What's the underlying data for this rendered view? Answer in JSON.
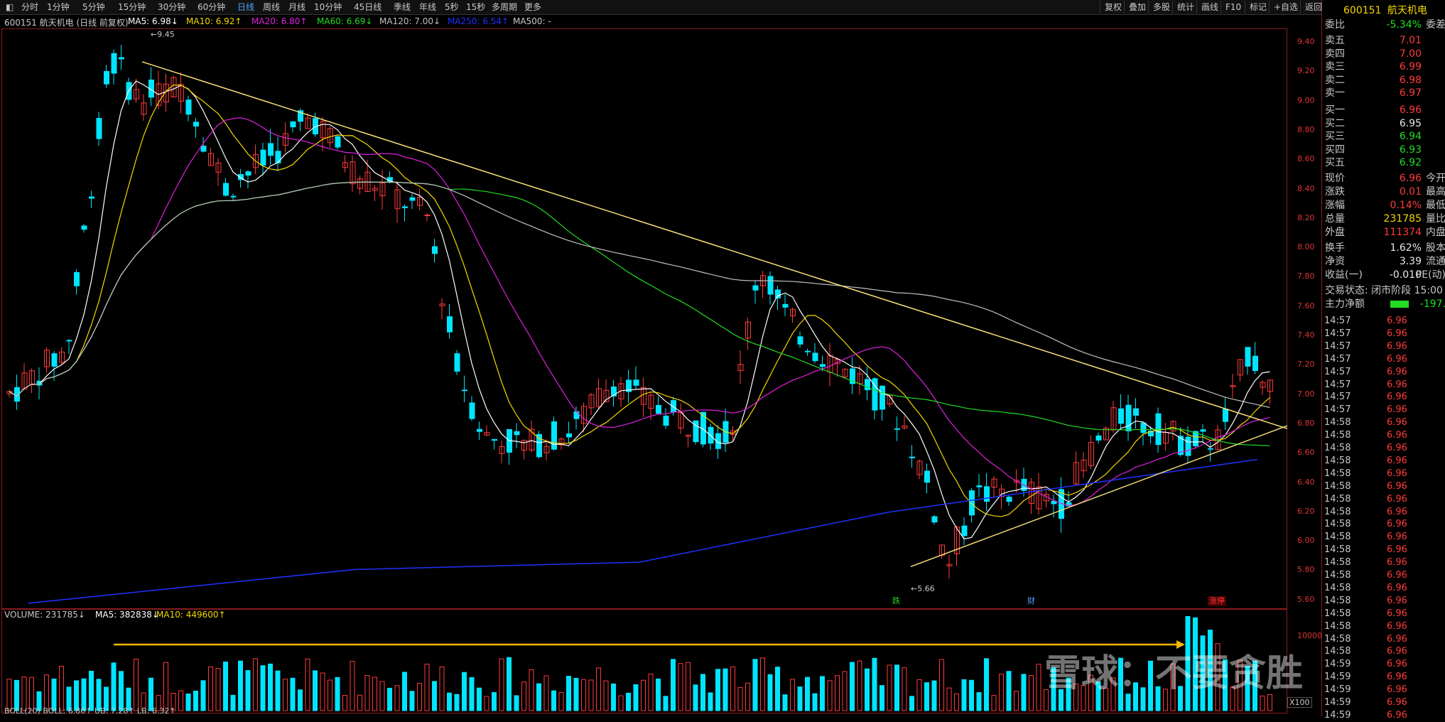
{
  "toolbar": {
    "periods": [
      "分时",
      "1分钟",
      "5分钟",
      "15分钟",
      "30分钟",
      "60分钟",
      "日线",
      "周线",
      "月线",
      "10分钟",
      "45日线",
      "季线",
      "年线",
      "5秒",
      "15秒",
      "多周期",
      "更多"
    ],
    "active_period": "日线",
    "right_buttons": [
      "复权",
      "叠加",
      "多股",
      "统计",
      "画线",
      "F10",
      "标记",
      "+自选",
      "返回"
    ]
  },
  "indicators": {
    "title": "600151 航天机电 (日线 前复权)",
    "ma5": "MA5: 6.98↓",
    "ma10": "MA10: 6.92↑",
    "ma20": "MA20: 6.80↑",
    "ma60": "MA60: 6.69↓",
    "ma120": "MA120: 7.00↓",
    "ma250": "MA250: 6.54↑",
    "ma500": "MA500: -"
  },
  "chart": {
    "y_labels": [
      "9.40",
      "9.20",
      "9.00",
      "8.80",
      "8.60",
      "8.40",
      "8.20",
      "8.00",
      "7.80",
      "7.60",
      "7.40",
      "7.20",
      "7.00",
      "6.80",
      "6.60",
      "6.40",
      "6.20",
      "6.00",
      "5.80",
      "5.60"
    ],
    "high_label": "9.45",
    "low_label": "5.66",
    "events": [
      {
        "text": "跌",
        "color": "#22dd22"
      },
      {
        "text": "财",
        "color": "#4da3ff"
      },
      {
        "text": "涨停",
        "color": "#ff3a3a"
      }
    ]
  },
  "volume": {
    "label": "VOLUME: 231785↓",
    "ma5": "MA5: 382838↓",
    "ma10": "MA10: 449600↑",
    "y_label": "10000",
    "scale": "X100",
    "boll": "BOLL(20) BOLL: 6.80↑ UB: 7.28↑ LB: 6.32↑"
  },
  "right_panel": {
    "code": "600151",
    "name": "航天机电",
    "weibi_label": "委比",
    "weibi": "-5.34%",
    "weicha_label": "委差",
    "asks": [
      {
        "label": "卖五",
        "price": "7.01"
      },
      {
        "label": "卖四",
        "price": "7.00"
      },
      {
        "label": "卖三",
        "price": "6.99"
      },
      {
        "label": "卖二",
        "price": "6.98"
      },
      {
        "label": "卖一",
        "price": "6.97"
      }
    ],
    "bids": [
      {
        "label": "买一",
        "price": "6.96"
      },
      {
        "label": "买二",
        "price": "6.95"
      },
      {
        "label": "买三",
        "price": "6.94"
      },
      {
        "label": "买四",
        "price": "6.93"
      },
      {
        "label": "买五",
        "price": "6.92"
      }
    ],
    "stats": [
      {
        "label": "现价",
        "value": "6.96",
        "label2": "今开"
      },
      {
        "label": "涨跌",
        "value": "0.01",
        "label2": "最高"
      },
      {
        "label": "涨幅",
        "value": "0.14%",
        "label2": "最低"
      },
      {
        "label": "总量",
        "value": "231785",
        "label2": "量比"
      },
      {
        "label": "外盘",
        "value": "111374",
        "label2": "内盘"
      }
    ],
    "stats2": [
      {
        "label": "换手",
        "value": "1.62%",
        "label2": "股本"
      },
      {
        "label": "净资",
        "value": "3.39",
        "label2": "流通"
      },
      {
        "label": "收益(一)",
        "value": "-0.010",
        "label2": "PE(动)"
      }
    ],
    "trade_status": "交易状态: 闭市阶段 15:00",
    "main_flow_label": "主力净额",
    "main_flow_value": "-197.",
    "ticks": [
      {
        "t": "14:57",
        "p": "6.96"
      },
      {
        "t": "14:57",
        "p": "6.96"
      },
      {
        "t": "14:57",
        "p": "6.96"
      },
      {
        "t": "14:57",
        "p": "6.96"
      },
      {
        "t": "14:57",
        "p": "6.96"
      },
      {
        "t": "14:57",
        "p": "6.96"
      },
      {
        "t": "14:57",
        "p": "6.96"
      },
      {
        "t": "14:57",
        "p": "6.96"
      },
      {
        "t": "14:58",
        "p": "6.96"
      },
      {
        "t": "14:58",
        "p": "6.96"
      },
      {
        "t": "14:58",
        "p": "6.96"
      },
      {
        "t": "14:58",
        "p": "6.96"
      },
      {
        "t": "14:58",
        "p": "6.96"
      },
      {
        "t": "14:58",
        "p": "6.96"
      },
      {
        "t": "14:58",
        "p": "6.96"
      },
      {
        "t": "14:58",
        "p": "6.96"
      },
      {
        "t": "14:58",
        "p": "6.96"
      },
      {
        "t": "14:58",
        "p": "6.96"
      },
      {
        "t": "14:58",
        "p": "6.96"
      },
      {
        "t": "14:58",
        "p": "6.96"
      },
      {
        "t": "14:58",
        "p": "6.96"
      },
      {
        "t": "14:58",
        "p": "6.96"
      },
      {
        "t": "14:58",
        "p": "6.96"
      },
      {
        "t": "14:58",
        "p": "6.96"
      },
      {
        "t": "14:58",
        "p": "6.96"
      },
      {
        "t": "14:58",
        "p": "6.96"
      },
      {
        "t": "14:58",
        "p": "6.96"
      },
      {
        "t": "14:59",
        "p": "6.96"
      },
      {
        "t": "14:59",
        "p": "6.96"
      },
      {
        "t": "14:59",
        "p": "6.96"
      },
      {
        "t": "14:59",
        "p": "6.96"
      },
      {
        "t": "14:59",
        "p": "6.96"
      }
    ]
  },
  "watermark": "雪球：不要贪胜",
  "colors": {
    "up": "#ff3a3a",
    "down": "#00e5ff",
    "ma5": "#ffffff",
    "ma10": "#f5d700",
    "ma20": "#e020e0",
    "ma60": "#22dd22",
    "ma120": "#c0c0c0",
    "ma250": "#2030ff"
  }
}
